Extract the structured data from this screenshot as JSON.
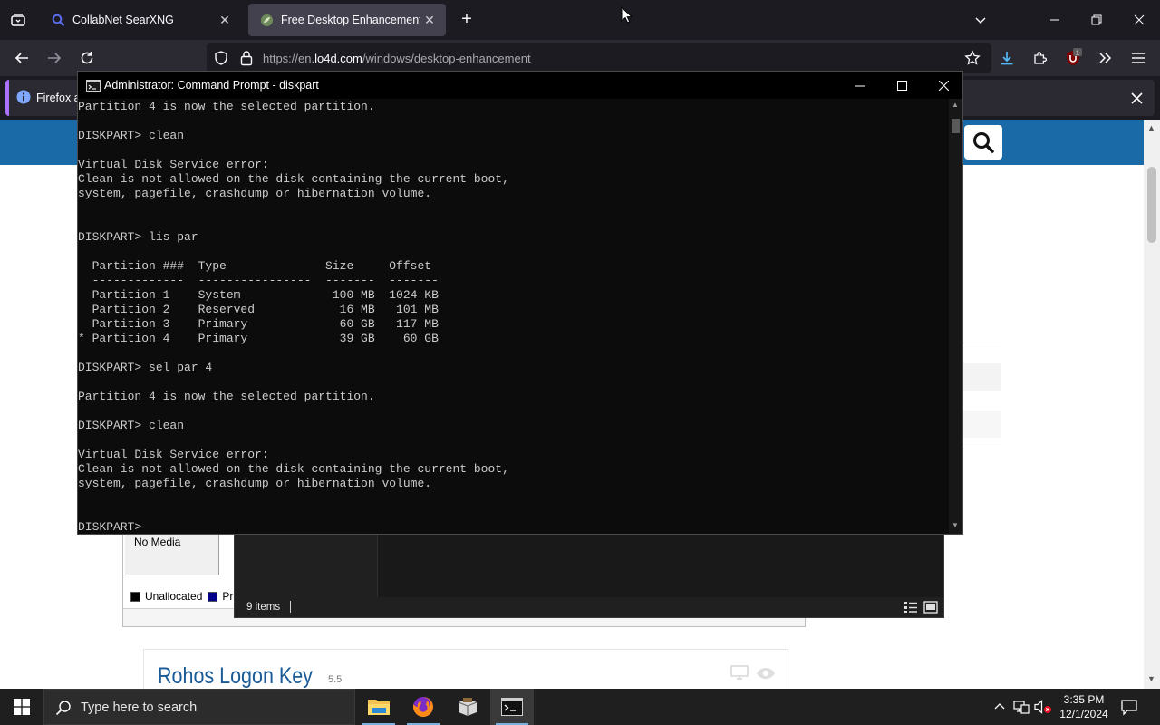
{
  "browser": {
    "tabs": [
      {
        "title": "CollabNet SearXNG",
        "active": false
      },
      {
        "title": "Free Desktop Enhancement Sof",
        "active": true
      }
    ],
    "url_prefix": "https://en.",
    "url_host": "lo4d.com",
    "url_path": "/windows/desktop-enhancement",
    "extension_badge": "1",
    "notification_text": "Firefox a"
  },
  "webpage": {
    "app_title": "Rohos Logon Key",
    "app_version": "5.5"
  },
  "diskmgmt": {
    "no_media": "No Media",
    "legend": [
      {
        "label": "Unallocated",
        "color": "#000000"
      },
      {
        "label": "Pri",
        "color": "#00008b"
      }
    ]
  },
  "explorer": {
    "item_count": "9 items"
  },
  "cmd": {
    "title": "Administrator: Command Prompt - diskpart",
    "lines": [
      "Partition 4 is now the selected partition.",
      "",
      "DISKPART> clean",
      "",
      "Virtual Disk Service error:",
      "Clean is not allowed on the disk containing the current boot,",
      "system, pagefile, crashdump or hibernation volume.",
      "",
      "",
      "DISKPART> lis par",
      "",
      "  Partition ###  Type              Size     Offset",
      "  -------------  ----------------  -------  -------",
      "  Partition 1    System             100 MB  1024 KB",
      "  Partition 2    Reserved            16 MB   101 MB",
      "  Partition 3    Primary             60 GB   117 MB",
      "* Partition 4    Primary             39 GB    60 GB",
      "",
      "DISKPART> sel par 4",
      "",
      "Partition 4 is now the selected partition.",
      "",
      "DISKPART> clean",
      "",
      "Virtual Disk Service error:",
      "Clean is not allowed on the disk containing the current boot,",
      "system, pagefile, crashdump or hibernation volume.",
      "",
      "",
      "DISKPART> "
    ]
  },
  "taskbar": {
    "search_placeholder": "Type here to search",
    "time": "3:35 PM",
    "date": "12/1/2024"
  },
  "colors": {
    "site_header": "#1a6aa8",
    "tab_active": "#42414d",
    "taskbar": "#1f1f1f",
    "cmd_background": "#0c0c0c"
  },
  "icons": {
    "browser": [
      "tab-list-icon",
      "search-icon",
      "leaf-icon",
      "close-icon",
      "plus-icon",
      "chevron-down-icon",
      "minimize-icon",
      "restore-icon",
      "back-arrow-icon",
      "forward-arrow-icon",
      "reload-icon",
      "shield-icon",
      "lock-icon",
      "star-icon",
      "download-icon",
      "puzzle-icon",
      "ublock-icon",
      "double-chevron-icon",
      "hamburger-menu-icon",
      "info-icon"
    ],
    "taskbar": [
      "windows-logo-icon",
      "search-icon",
      "file-explorer-icon",
      "firefox-icon",
      "package-icon",
      "terminal-icon",
      "chevron-up-icon",
      "network-icon",
      "volume-muted-icon",
      "notification-icon"
    ]
  }
}
